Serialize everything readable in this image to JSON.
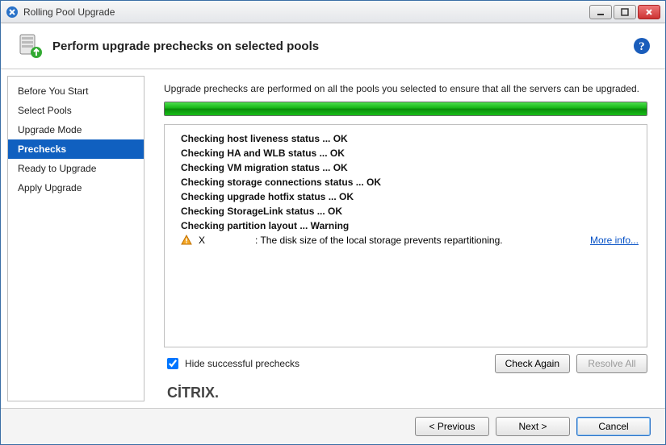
{
  "window": {
    "title": "Rolling Pool Upgrade"
  },
  "header": {
    "title": "Perform upgrade prechecks on selected pools"
  },
  "sidebar": {
    "items": [
      {
        "label": "Before You Start",
        "active": false
      },
      {
        "label": "Select Pools",
        "active": false
      },
      {
        "label": "Upgrade Mode",
        "active": false
      },
      {
        "label": "Prechecks",
        "active": true
      },
      {
        "label": "Ready to Upgrade",
        "active": false
      },
      {
        "label": "Apply Upgrade",
        "active": false
      }
    ]
  },
  "content": {
    "description": "Upgrade prechecks are performed on all the pools you selected to ensure that all the servers can be upgraded.",
    "progress_percent": 100,
    "checks": [
      "Checking host liveness status ... OK",
      "Checking HA and WLB status ... OK",
      "Checking VM migration status ... OK",
      "Checking storage connections status ... OK",
      "Checking upgrade hotfix status ... OK",
      "Checking StorageLink status ... OK",
      "Checking partition layout ... Warning"
    ],
    "warning": {
      "host": "X",
      "message": ": The disk size of the local storage prevents repartitioning.",
      "more_info": "More info..."
    },
    "hide_successful_label": "Hide successful prechecks",
    "hide_successful_checked": true,
    "check_again": "Check Again",
    "resolve_all": "Resolve All"
  },
  "brand": "CİTRIX",
  "footer": {
    "previous": "< Previous",
    "next": "Next >",
    "cancel": "Cancel"
  }
}
